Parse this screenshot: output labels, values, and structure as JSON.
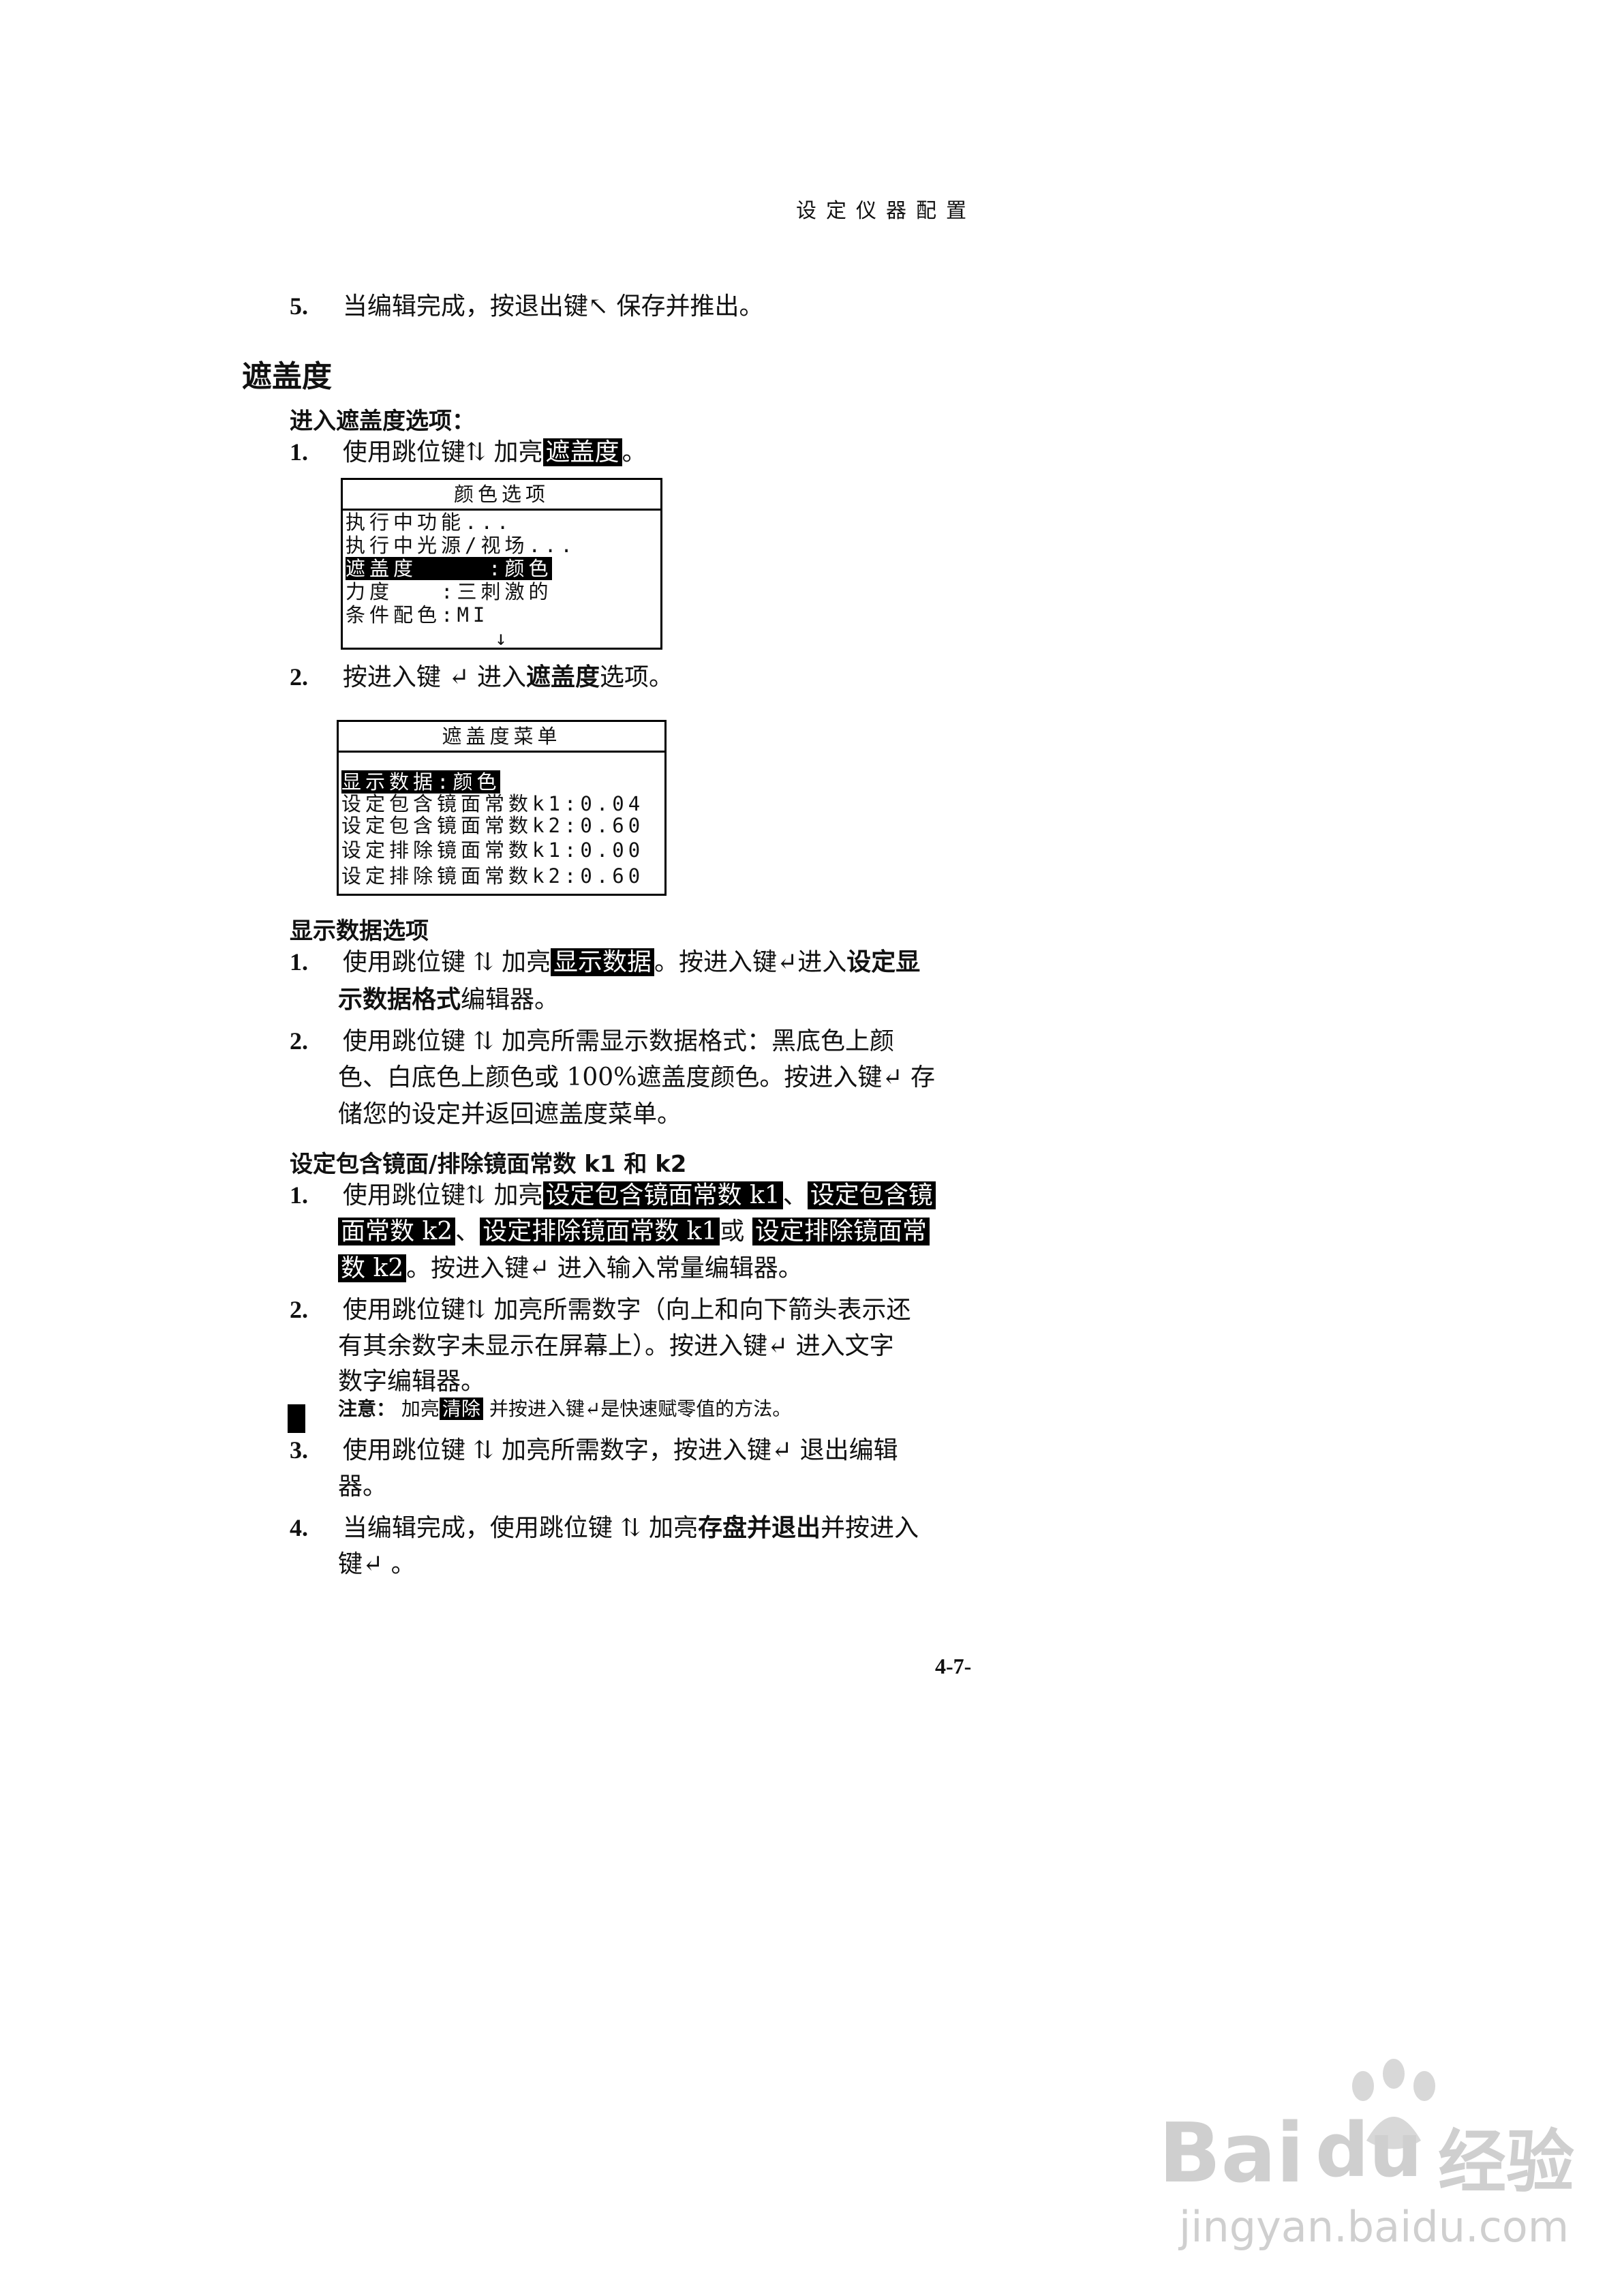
{
  "header": {
    "title": "设定仪器配置"
  },
  "step5_top": {
    "num": "5.",
    "text_a": "当编辑完成，按退出键",
    "icon": "↖",
    "text_b": " 保存并推出。"
  },
  "section": {
    "title": "遮盖度"
  },
  "enter_opt": {
    "heading": "进入遮盖度选项：",
    "s1": {
      "num": "1.",
      "a": "使用跳位键",
      "arrows": "⇅",
      "b": " 加亮",
      "hl": "遮盖度",
      "c": "。"
    },
    "s2": {
      "num": "2.",
      "a": "按进入键 ",
      "enter": "↵",
      "b": " 进入",
      "bold": "遮盖度",
      "c": "选项。"
    }
  },
  "screen1": {
    "title": "颜色选项",
    "rows": [
      "执行中功能...",
      "执行中光源/视场...",
      "遮盖度　　　:颜色",
      "力度　　:三刺激的",
      "条件配色:MI"
    ],
    "scroll": "↓"
  },
  "screen2": {
    "title": "遮盖度菜单",
    "rows": [
      "显示数据:颜色",
      "设定包含镜面常数k1:0.04",
      "设定包含镜面常数k2:0.60",
      "设定排除镜面常数k1:0.00",
      "设定排除镜面常数k2:0.60"
    ]
  },
  "display": {
    "heading": "显示数据选项",
    "s1": {
      "num": "1.",
      "a": "使用跳位键 ",
      "arrows": "⇅",
      "b": " 加亮",
      "hl": "显示数据",
      "c": "。按进入键",
      "enter": "↵",
      "d": "进入",
      "bold": "设定显",
      "line2_bold": "示数据格式",
      "line2": "编辑器。"
    },
    "s2": {
      "num": "2.",
      "line1": "使用跳位键 ⇅ 加亮所需显示数据格式：黑底色上颜",
      "line2": "色、白底色上颜色或 100%遮盖度颜色。按进入键↵ 存",
      "line3": "储您的设定并返回遮盖度菜单。"
    }
  },
  "k_section": {
    "heading": "设定包含镜面/排除镜面常数 k1 和 k2",
    "s1": {
      "num": "1.",
      "a": "使用跳位键⇅ 加亮",
      "hl1": "设定包含镜面常数 k1",
      "sep1": "、",
      "hl2a": "设定包含镜",
      "hl2b": "面常数 k2",
      "sep2": "、",
      "hl3": "设定排除镜面常数 k1",
      "or": "或",
      "hl4a": "设定排除镜面常",
      "hl4b": "数 k2",
      "tail": "。按进入键↵ 进入输入常量编辑器。"
    },
    "s2": {
      "num": "2.",
      "line1": "使用跳位键⇅ 加亮所需数字（向上和向下箭头表示还",
      "line2": "有其余数字未显示在屏幕上）。按进入键↵ 进入文字",
      "line3": "数字编辑器。"
    },
    "note": {
      "label": "注意：",
      "a": " 加亮",
      "hl": "清除",
      "b": " 并按进入键↵是快速赋零值的方法。"
    },
    "s3": {
      "num": "3.",
      "line1": "使用跳位键 ⇅ 加亮所需数字，按进入键↵ 退出编辑",
      "line2": "器。"
    },
    "s4": {
      "num": "4.",
      "a": "当编辑完成，使用跳位键 ⇅ 加亮",
      "bold": "存盘并退出",
      "b": "并按进入",
      "line2": "键↵ 。"
    }
  },
  "footer": {
    "page": "4-7-"
  },
  "watermark": {
    "logo": "Bai",
    "paw": "du",
    "text": "经验",
    "url": "jingyan.baidu.com"
  }
}
